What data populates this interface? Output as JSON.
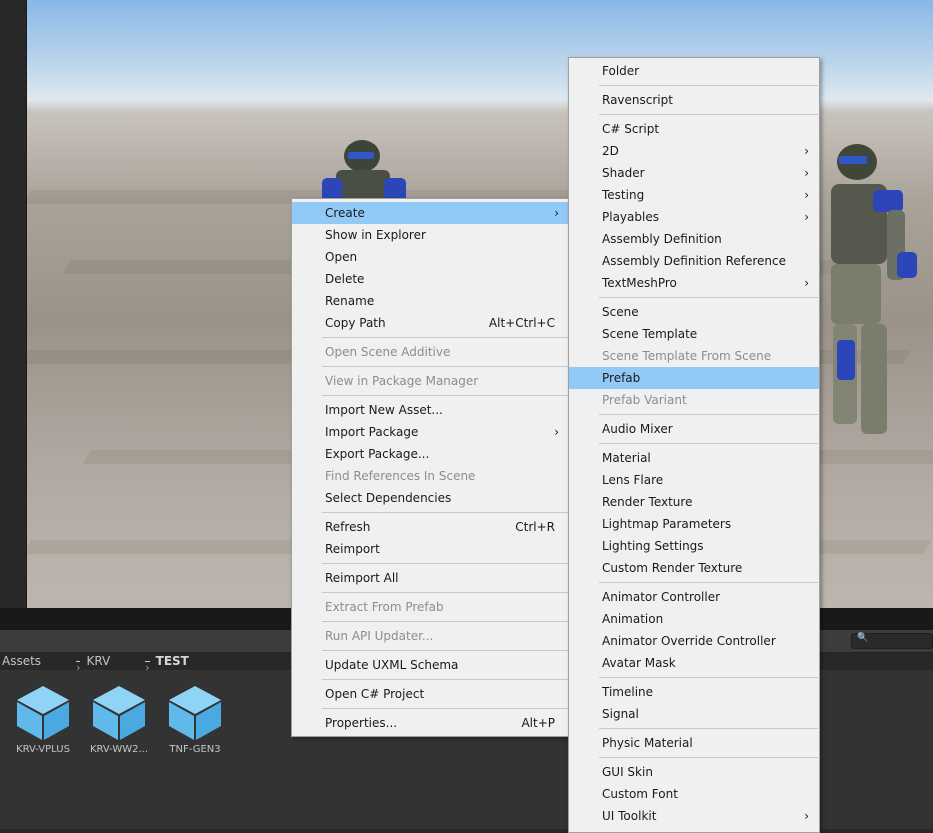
{
  "breadcrumb": [
    "Assets",
    "KRV",
    "TEST"
  ],
  "assets": [
    {
      "label": "KRV-VPLUS",
      "icon": "prefab-cube-icon"
    },
    {
      "label": "KRV-WW2...",
      "icon": "prefab-cube-icon"
    },
    {
      "label": "TNF-GEN3",
      "icon": "prefab-cube-icon"
    }
  ],
  "search": {
    "icon": "search-icon",
    "glyph": "🔍"
  },
  "context_menu": {
    "groups": [
      [
        {
          "label": "Create",
          "submenu": true,
          "highlight": true
        },
        {
          "label": "Show in Explorer"
        },
        {
          "label": "Open"
        },
        {
          "label": "Delete"
        },
        {
          "label": "Rename"
        },
        {
          "label": "Copy Path",
          "shortcut": "Alt+Ctrl+C"
        }
      ],
      [
        {
          "label": "Open Scene Additive",
          "disabled": true
        }
      ],
      [
        {
          "label": "View in Package Manager",
          "disabled": true
        }
      ],
      [
        {
          "label": "Import New Asset..."
        },
        {
          "label": "Import Package",
          "submenu": true
        },
        {
          "label": "Export Package..."
        },
        {
          "label": "Find References In Scene",
          "disabled": true
        },
        {
          "label": "Select Dependencies"
        }
      ],
      [
        {
          "label": "Refresh",
          "shortcut": "Ctrl+R"
        },
        {
          "label": "Reimport"
        }
      ],
      [
        {
          "label": "Reimport All"
        }
      ],
      [
        {
          "label": "Extract From Prefab",
          "disabled": true
        }
      ],
      [
        {
          "label": "Run API Updater...",
          "disabled": true
        }
      ],
      [
        {
          "label": "Update UXML Schema"
        }
      ],
      [
        {
          "label": "Open C# Project"
        }
      ],
      [
        {
          "label": "Properties...",
          "shortcut": "Alt+P"
        }
      ]
    ]
  },
  "create_submenu": {
    "groups": [
      [
        {
          "label": "Folder"
        }
      ],
      [
        {
          "label": "Ravenscript"
        }
      ],
      [
        {
          "label": "C# Script"
        },
        {
          "label": "2D",
          "submenu": true
        },
        {
          "label": "Shader",
          "submenu": true
        },
        {
          "label": "Testing",
          "submenu": true
        },
        {
          "label": "Playables",
          "submenu": true
        },
        {
          "label": "Assembly Definition"
        },
        {
          "label": "Assembly Definition Reference"
        },
        {
          "label": "TextMeshPro",
          "submenu": true
        }
      ],
      [
        {
          "label": "Scene"
        },
        {
          "label": "Scene Template"
        },
        {
          "label": "Scene Template From Scene",
          "disabled": true
        },
        {
          "label": "Prefab",
          "highlight": true
        },
        {
          "label": "Prefab Variant",
          "disabled": true
        }
      ],
      [
        {
          "label": "Audio Mixer"
        }
      ],
      [
        {
          "label": "Material"
        },
        {
          "label": "Lens Flare"
        },
        {
          "label": "Render Texture"
        },
        {
          "label": "Lightmap Parameters"
        },
        {
          "label": "Lighting Settings"
        },
        {
          "label": "Custom Render Texture"
        }
      ],
      [
        {
          "label": "Animator Controller"
        },
        {
          "label": "Animation"
        },
        {
          "label": "Animator Override Controller"
        },
        {
          "label": "Avatar Mask"
        }
      ],
      [
        {
          "label": "Timeline"
        },
        {
          "label": "Signal"
        }
      ],
      [
        {
          "label": "Physic Material"
        }
      ],
      [
        {
          "label": "GUI Skin"
        },
        {
          "label": "Custom Font"
        },
        {
          "label": "UI Toolkit",
          "submenu": true
        }
      ]
    ]
  },
  "icons": {
    "submenu_arrow": "›",
    "breadcrumb_sep": "›"
  },
  "colors": {
    "highlight": "#91c9f7",
    "menu_bg": "#f0f0f0",
    "prefab_icon": "#6dc3ef"
  }
}
